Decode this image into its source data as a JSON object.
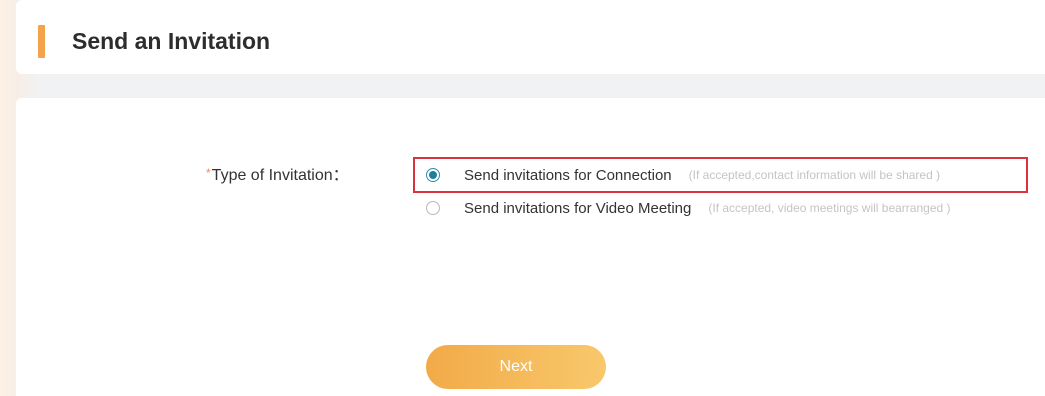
{
  "header": {
    "title": "Send an Invitation"
  },
  "form": {
    "required_mark": "*",
    "label": "Type of Invitation：",
    "options": [
      {
        "label": "Send invitations for Connection",
        "hint": "(If accepted,contact information will be shared )",
        "selected": true
      },
      {
        "label": "Send invitations for Video Meeting",
        "hint": "(If accepted, video meetings will bearranged )",
        "selected": false
      }
    ]
  },
  "actions": {
    "next_label": "Next"
  },
  "colors": {
    "accent": "#f4a34c",
    "radio_selected": "#1f7f99",
    "highlight_border": "#d9343d"
  }
}
